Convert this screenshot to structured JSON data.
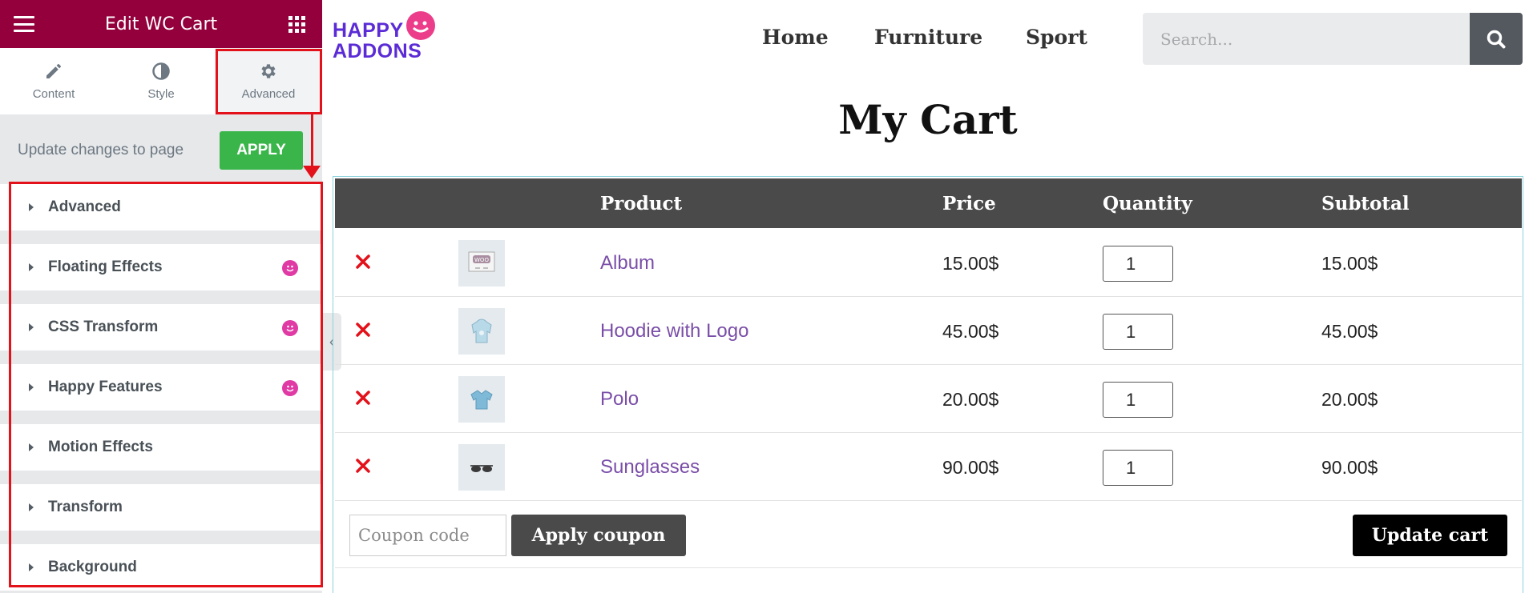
{
  "panel": {
    "title": "Edit WC Cart",
    "header_color": "#93003c",
    "tabs": [
      {
        "label": "Content",
        "icon": "pencil-icon"
      },
      {
        "label": "Style",
        "icon": "half-circle-icon"
      },
      {
        "label": "Advanced",
        "icon": "gear-icon",
        "active": true
      }
    ],
    "update_text": "Update changes to page",
    "apply_label": "APPLY",
    "sections": [
      {
        "label": "Advanced",
        "happy": false
      },
      {
        "label": "Floating Effects",
        "happy": true
      },
      {
        "label": "CSS Transform",
        "happy": true
      },
      {
        "label": "Happy Features",
        "happy": true
      },
      {
        "label": "Motion Effects",
        "happy": false
      },
      {
        "label": "Transform",
        "happy": false
      },
      {
        "label": "Background",
        "happy": false
      }
    ]
  },
  "site": {
    "logo_line1": "HAPPY",
    "logo_line2": "ADDONS",
    "nav": [
      "Home",
      "Furniture",
      "Sport"
    ],
    "search_placeholder": "Search...",
    "page_title": "My Cart"
  },
  "cart": {
    "headers": {
      "product": "Product",
      "price": "Price",
      "quantity": "Quantity",
      "subtotal": "Subtotal"
    },
    "rows": [
      {
        "name": "Album",
        "price": "15.00$",
        "qty": "1",
        "subtotal": "15.00$"
      },
      {
        "name": "Hoodie with Logo",
        "price": "45.00$",
        "qty": "1",
        "subtotal": "45.00$"
      },
      {
        "name": "Polo",
        "price": "20.00$",
        "qty": "1",
        "subtotal": "20.00$"
      },
      {
        "name": "Sunglasses",
        "price": "90.00$",
        "qty": "1",
        "subtotal": "90.00$"
      }
    ],
    "coupon_placeholder": "Coupon code",
    "apply_coupon_label": "Apply coupon",
    "update_cart_label": "Update cart"
  },
  "colors": {
    "accent_red": "#e3111a",
    "apply_green": "#39b54a",
    "product_link": "#7a4ea8"
  }
}
